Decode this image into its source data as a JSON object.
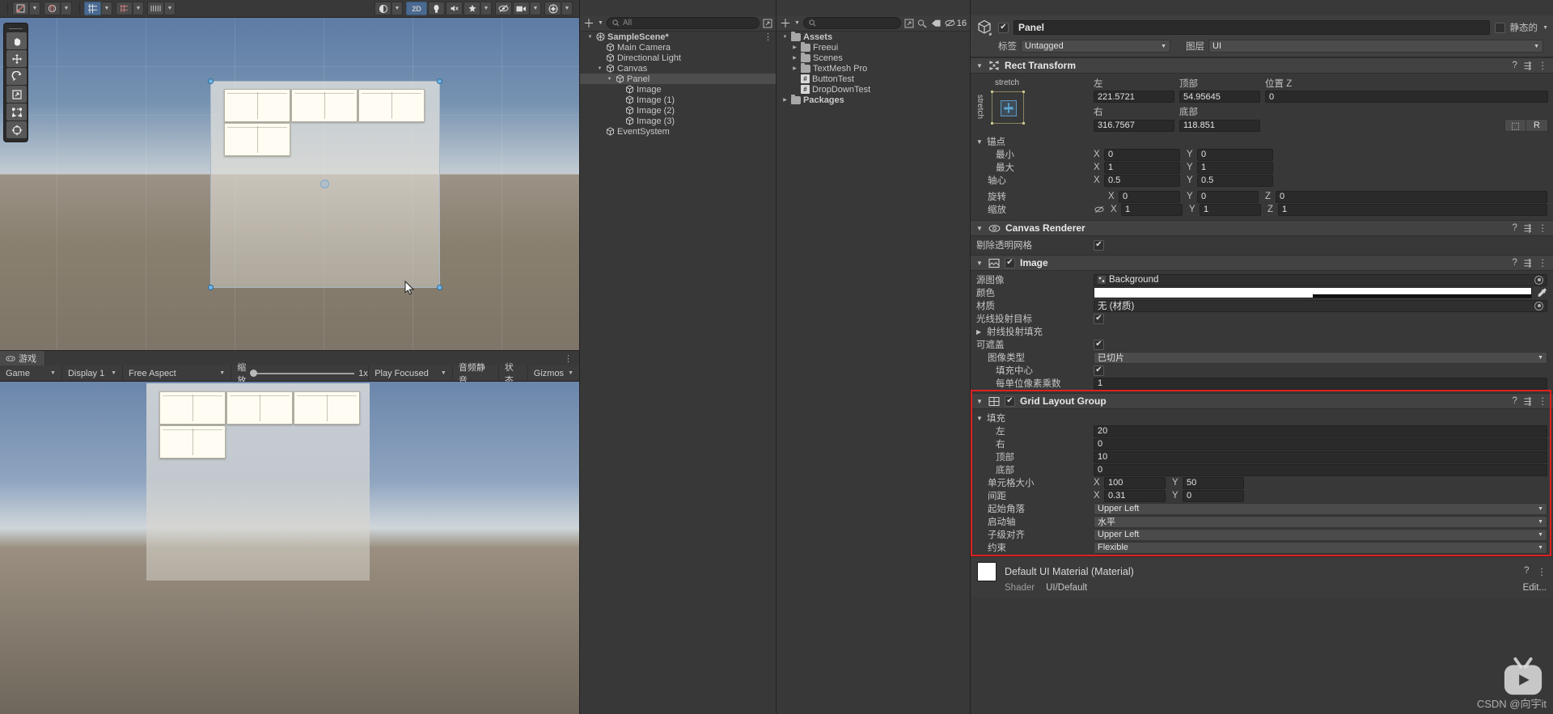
{
  "scene_toolbar": {
    "left_tools": [
      {
        "name": "pivot-mode",
        "label": "◪"
      },
      {
        "name": "handle-rotation",
        "label": "◍"
      },
      {
        "name": "grid-snap",
        "label": "▦"
      },
      {
        "name": "grid-visibility",
        "label": "▤"
      },
      {
        "name": "snap-increment",
        "label": "|||"
      }
    ],
    "right_tools": [
      {
        "name": "shading-mode",
        "label": "◐"
      },
      {
        "name": "view-2d",
        "label": "2D"
      },
      {
        "name": "lighting",
        "label": "☀"
      },
      {
        "name": "audio",
        "label": "🔇"
      },
      {
        "name": "effects",
        "label": "✦"
      },
      {
        "name": "scene-visibility",
        "label": "👁"
      },
      {
        "name": "camera-settings",
        "label": "◧"
      },
      {
        "name": "gizmos",
        "label": "◉"
      }
    ]
  },
  "scene_tools": [
    {
      "name": "hand-tool",
      "label": "✋",
      "selected": true
    },
    {
      "name": "move-tool",
      "label": "✥",
      "selected": false
    },
    {
      "name": "rotate-tool",
      "label": "⟳",
      "selected": false
    },
    {
      "name": "scale-tool",
      "label": "⤢",
      "selected": false
    },
    {
      "name": "rect-tool",
      "label": "⬚",
      "selected": false
    },
    {
      "name": "transform-tool",
      "label": "✜",
      "selected": false
    }
  ],
  "game_view": {
    "tab_label": "游戏",
    "mode": "Game",
    "display": "Display 1",
    "aspect": "Free Aspect",
    "zoom_label": "缩放",
    "zoom_value": "1x",
    "play_mode": "Play Focused",
    "mute": "音频静音",
    "stats": "状态",
    "gizmos": "Gizmos"
  },
  "hierarchy": {
    "search_placeholder": "All",
    "items": [
      {
        "label": "SampleScene*",
        "depth": 0,
        "icon": "scene-icon",
        "expanded": true,
        "selected": false,
        "bold": true
      },
      {
        "label": "Main Camera",
        "depth": 1,
        "icon": "gameobject-icon",
        "expanded": null,
        "selected": false
      },
      {
        "label": "Directional Light",
        "depth": 1,
        "icon": "gameobject-icon",
        "expanded": null,
        "selected": false
      },
      {
        "label": "Canvas",
        "depth": 1,
        "icon": "gameobject-icon",
        "expanded": true,
        "selected": false
      },
      {
        "label": "Panel",
        "depth": 2,
        "icon": "gameobject-icon",
        "expanded": true,
        "selected": true
      },
      {
        "label": "Image",
        "depth": 3,
        "icon": "gameobject-icon",
        "expanded": null,
        "selected": false
      },
      {
        "label": "Image (1)",
        "depth": 3,
        "icon": "gameobject-icon",
        "expanded": null,
        "selected": false
      },
      {
        "label": "Image (2)",
        "depth": 3,
        "icon": "gameobject-icon",
        "expanded": null,
        "selected": false
      },
      {
        "label": "Image (3)",
        "depth": 3,
        "icon": "gameobject-icon",
        "expanded": null,
        "selected": false
      },
      {
        "label": "EventSystem",
        "depth": 1,
        "icon": "gameobject-icon",
        "expanded": null,
        "selected": false
      }
    ]
  },
  "project": {
    "search_placeholder": "",
    "visible_count": "16",
    "items": [
      {
        "label": "Assets",
        "depth": 0,
        "icon": "folder-icon",
        "expanded": true,
        "bold": true
      },
      {
        "label": "Freeui",
        "depth": 1,
        "icon": "folder-icon",
        "expanded": false
      },
      {
        "label": "Scenes",
        "depth": 1,
        "icon": "folder-icon",
        "expanded": false
      },
      {
        "label": "TextMesh Pro",
        "depth": 1,
        "icon": "folder-icon",
        "expanded": false
      },
      {
        "label": "ButtonTest",
        "depth": 1,
        "icon": "script-icon",
        "expanded": null
      },
      {
        "label": "DropDownTest",
        "depth": 1,
        "icon": "script-icon",
        "expanded": null
      },
      {
        "label": "Packages",
        "depth": 0,
        "icon": "folder-icon",
        "expanded": false,
        "bold": true
      }
    ]
  },
  "inspector": {
    "tab_label": "",
    "gameobject": {
      "enabled": true,
      "name": "Panel",
      "static_label": "静态的",
      "static_checked": false,
      "tag_label": "标签",
      "tag_value": "Untagged",
      "layer_label": "图层",
      "layer_value": "UI"
    },
    "rect_transform": {
      "title": "Rect Transform",
      "anchor_preset_top": "stretch",
      "anchor_preset_left": "stretch",
      "left_label": "左",
      "left_value": "221.5721",
      "top_label": "顶部",
      "top_value": "54.95645",
      "posz_label": "位置 Z",
      "posz_value": "0",
      "right_label": "右",
      "right_value": "316.7567",
      "bottom_label": "底部",
      "bottom_value": "118.851",
      "blueprint_btn": "⬚",
      "raw_btn": "R",
      "anchors_label": "锚点",
      "min_label": "最小",
      "min_x": "0",
      "min_y": "0",
      "max_label": "最大",
      "max_x": "1",
      "max_y": "1",
      "pivot_label": "轴心",
      "pivot_x": "0.5",
      "pivot_y": "0.5",
      "rotation_label": "旋转",
      "rot_x": "0",
      "rot_y": "0",
      "rot_z": "0",
      "scale_label": "缩放",
      "scale_x": "1",
      "scale_y": "1",
      "scale_z": "1"
    },
    "canvas_renderer": {
      "title": "Canvas Renderer",
      "cull_label": "剔除透明网格",
      "cull_checked": true
    },
    "image": {
      "title": "Image",
      "enabled": true,
      "source_label": "源图像",
      "source_value": "Background",
      "color_label": "颜色",
      "color_value": "#FFFFFF",
      "material_label": "材质",
      "material_value": "无 (材质)",
      "raycast_target_label": "光线投射目标",
      "raycast_target_checked": true,
      "raycast_padding_label": "射线投射填充",
      "maskable_label": "可遮盖",
      "maskable_checked": true,
      "image_type_label": "图像类型",
      "image_type_value": "已切片",
      "fill_center_label": "填充中心",
      "fill_center_checked": true,
      "ppu_label": "每单位像素乘数",
      "ppu_value": "1"
    },
    "grid_layout_group": {
      "title": "Grid Layout Group",
      "enabled": true,
      "highlight_color": "#E02020",
      "padding_label": "填充",
      "left_label": "左",
      "left_value": "20",
      "right_label": "右",
      "right_value": "0",
      "top_label": "顶部",
      "top_value": "10",
      "bottom_label": "底部",
      "bottom_value": "0",
      "cell_size_label": "单元格大小",
      "cell_x": "100",
      "cell_y": "50",
      "spacing_label": "间距",
      "spacing_x": "0.31",
      "spacing_y": "0",
      "start_corner_label": "起始角落",
      "start_corner_value": "Upper Left",
      "start_axis_label": "启动轴",
      "start_axis_value": "水平",
      "child_alignment_label": "子级对齐",
      "child_alignment_value": "Upper Left",
      "constraint_label": "约束",
      "constraint_value": "Flexible"
    },
    "material_preview": {
      "title": "Default UI Material (Material)",
      "shader_label": "Shader",
      "shader_value": "UI/Default",
      "edit_label": "Edit..."
    },
    "watermark": "CSDN @向宇it"
  }
}
